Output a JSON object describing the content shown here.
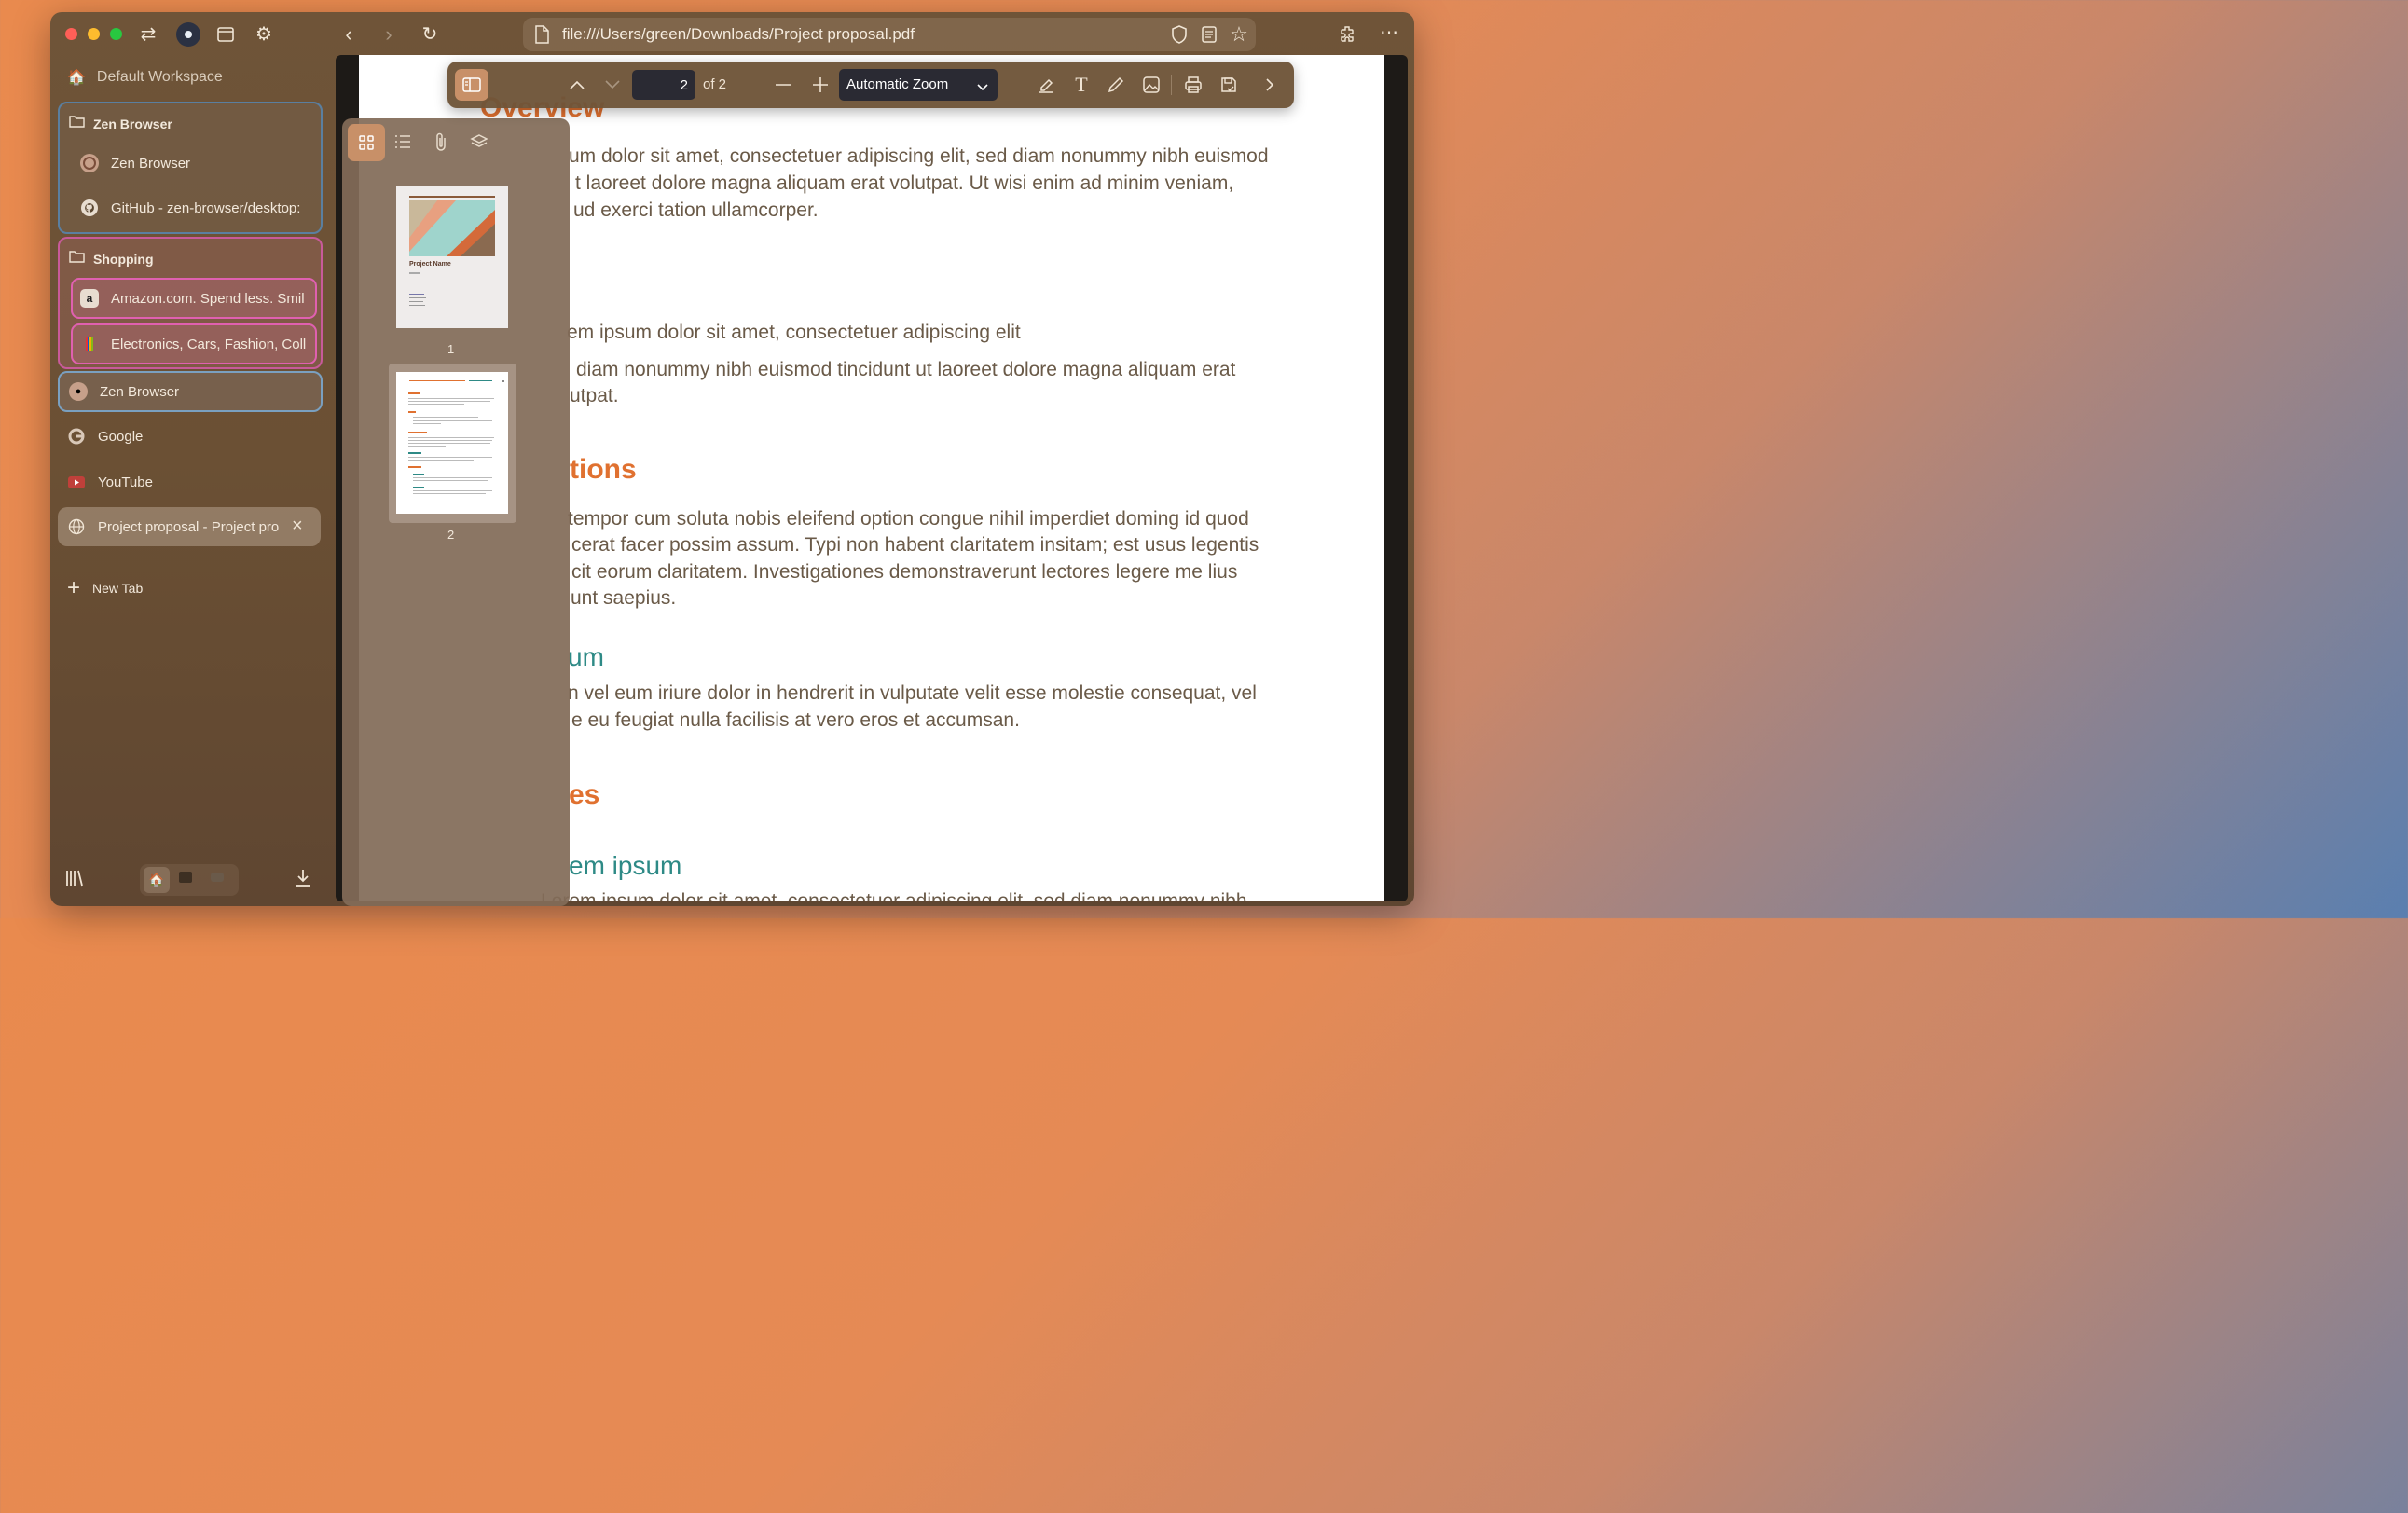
{
  "browser": {
    "url": "file:///Users/green/Downloads/Project proposal.pdf"
  },
  "sidebar": {
    "workspace": "Default Workspace",
    "folders": [
      {
        "name": "Zen Browser",
        "tabs": [
          "Zen Browser",
          "GitHub - zen-browser/desktop:"
        ]
      },
      {
        "name": "Shopping",
        "tabs": [
          "Amazon.com. Spend less. Smil",
          "Electronics, Cars, Fashion, Coll"
        ]
      }
    ],
    "tabs": [
      {
        "label": "Zen Browser"
      },
      {
        "label": "Google"
      },
      {
        "label": "YouTube"
      },
      {
        "label": "Project proposal - Project pro"
      }
    ],
    "new_tab": "New Tab"
  },
  "pdf_toolbar": {
    "page_number": "2",
    "page_total": "of 2",
    "zoom": "Automatic Zoom"
  },
  "thumbnails": {
    "pages": [
      "1",
      "2"
    ],
    "page1_title": "Project Name"
  },
  "document": {
    "heading_overview": "Overview",
    "para1_line1": "um dolor sit amet, consectetuer adipiscing elit, sed diam nonummy nibh euismod",
    "para1_line2": "t laoreet dolore magna aliquam erat volutpat. Ut wisi enim ad minim veniam,",
    "para1_line3": "ud exerci tation ullamcorper.",
    "bullet1": "em ipsum dolor sit amet, consectetuer adipiscing elit",
    "bullet2_line1": "diam nonummy nibh euismod tincidunt ut laoreet dolore magna aliquam erat",
    "bullet2_line2": "utpat.",
    "heading_specs": "tions",
    "para2_line1": "tempor cum soluta nobis eleifend option congue nihil imperdiet doming id quod",
    "para2_line2": "cerat facer possim assum. Typi non habent claritatem insitam; est usus legentis",
    "para2_line3": "cit eorum claritatem. Investigationes demonstraverunt lectores legere me lius",
    "para2_line4": "unt saepius.",
    "subheading1": "um",
    "para3_line1": "n vel eum iriure dolor in hendrerit in vulputate velit esse molestie consequat, vel",
    "para3_line2": "e eu feugiat nulla facilisis at vero eros et accumsan.",
    "heading_milestones": "es",
    "subheading2": "em ipsum",
    "para4_line1": "Lorem ipsum dolor sit amet, consectetuer adipiscing elit, sed diam nonummy nibh"
  },
  "colors": {
    "accent_orange": "#e07130",
    "accent_teal": "#2e8a86",
    "folder1_border": "#5a7fa0",
    "folder2_border": "#c85a9a"
  }
}
